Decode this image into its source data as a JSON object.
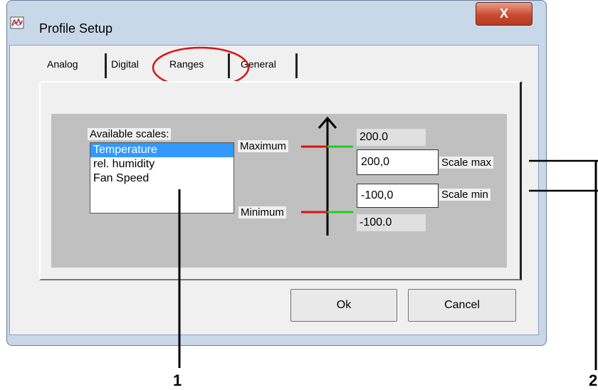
{
  "window": {
    "title": "Profile Setup",
    "close_label": "X"
  },
  "tabs": [
    {
      "label": "Analog"
    },
    {
      "label": "Digital"
    },
    {
      "label": "Ranges"
    },
    {
      "label": "General"
    }
  ],
  "active_tab": "Ranges",
  "scales": {
    "label": "Available scales:",
    "items": [
      {
        "label": "Temperature",
        "selected": true
      },
      {
        "label": "rel. humidity",
        "selected": false
      },
      {
        "label": "Fan Speed",
        "selected": false
      }
    ]
  },
  "range": {
    "maximum_label": "Maximum",
    "minimum_label": "Minimum",
    "max_readout": "200.0",
    "min_readout": "-100.0",
    "scale_max_value": "200,0",
    "scale_min_value": "-100,0",
    "scale_max_label": "Scale max",
    "scale_min_label": "Scale min"
  },
  "buttons": {
    "ok": "Ok",
    "cancel": "Cancel"
  },
  "callouts": {
    "one": "1",
    "two": "2"
  },
  "colors": {
    "highlight_circle": "#e01010",
    "selected_item": "#3399ff",
    "marker_red": "#e01010",
    "marker_green": "#22cc22"
  }
}
